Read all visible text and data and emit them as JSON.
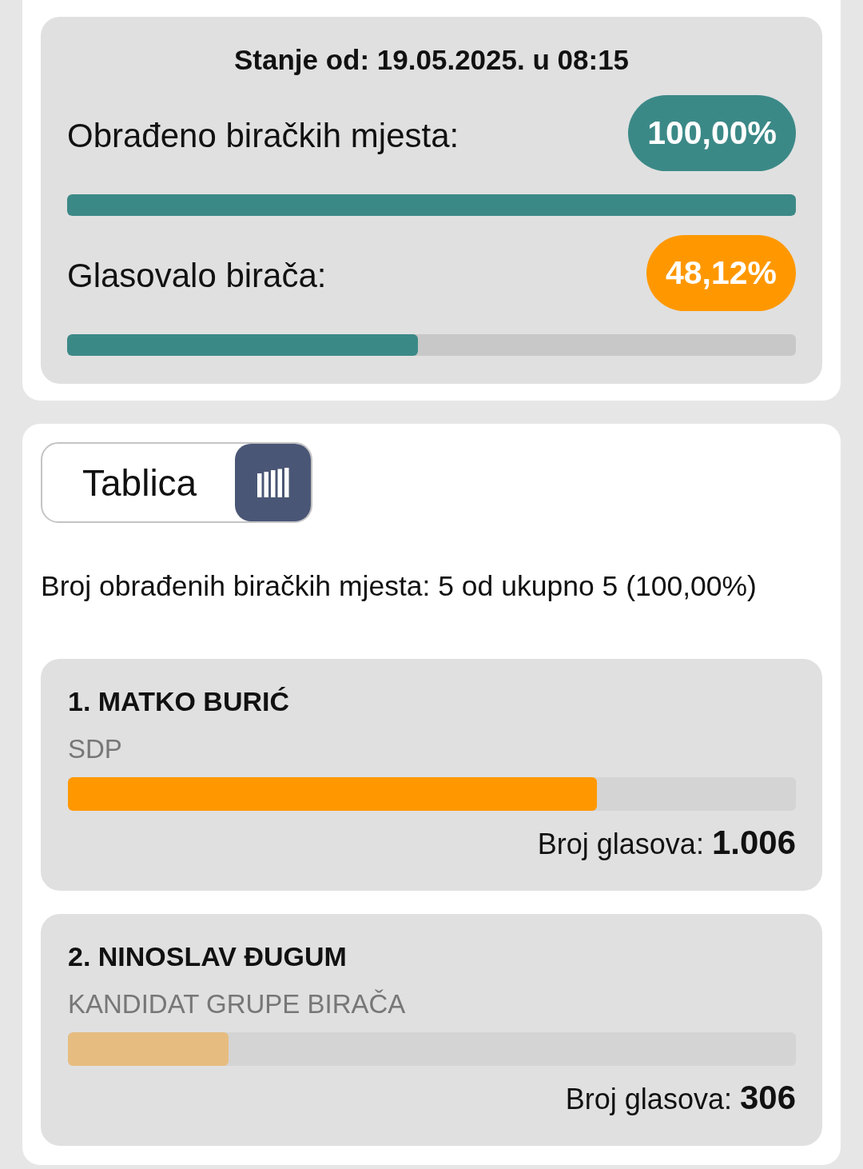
{
  "status": {
    "title": "Stanje od: 19.05.2025. u 08:15",
    "stats": [
      {
        "label": "Obrađeno biračkih mjesta:",
        "value": "100,00%",
        "color": "#3b8987",
        "level": 1
      },
      {
        "label": "Glasovalo birača:",
        "value": "48,12%",
        "color": "#ff9800",
        "level": 0.481
      }
    ]
  },
  "results": {
    "toggle": {
      "label": "Tablica"
    },
    "summary": "Broj obrađenih biračkih mjesta: 5 od ukupno 5 (100,00%)",
    "candidates": [
      {
        "name": "1. MATKO BURIĆ",
        "party": "SDP",
        "level": 0.727,
        "color": "#ff9800",
        "votes": "Broj glasova: **1.006**"
      },
      {
        "name": "2. NINOSLAV ĐUGUM",
        "party": "KANDIDAT GRUPE BIRAČA",
        "level": 0.221,
        "color": "#e6bc80",
        "votes": "Broj glasova: **306**"
      }
    ]
  }
}
